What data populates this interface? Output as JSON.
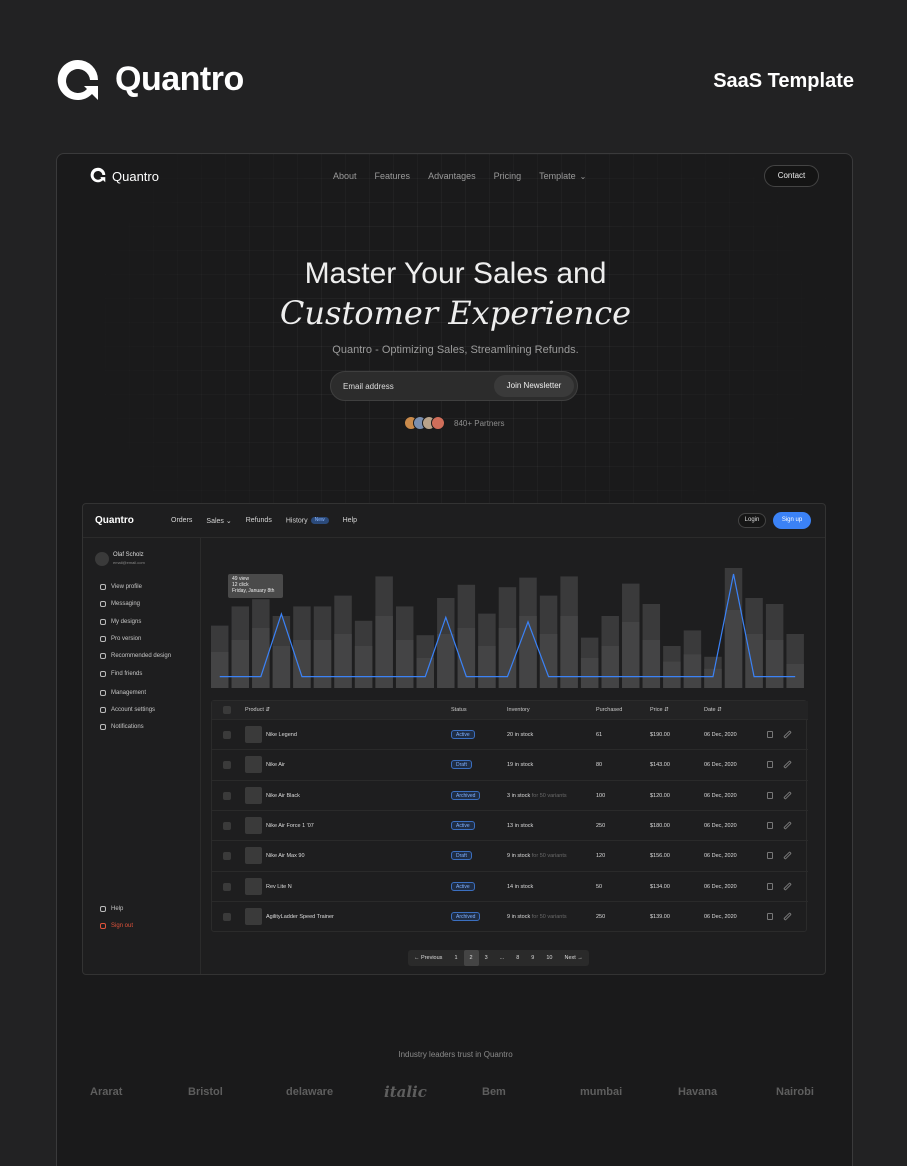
{
  "banner": {
    "brand": "Quantro",
    "tagline": "SaaS Template"
  },
  "site": {
    "logo_text": "Quantro",
    "nav": [
      "About",
      "Features",
      "Advantages",
      "Pricing",
      "Template"
    ],
    "contact": "Contact",
    "hero_line1": "Master Your Sales and",
    "hero_line2": "Customer Experience",
    "subtitle": "Quantro - Optimizing Sales, Streamlining Refunds.",
    "email_placeholder": "Email address",
    "join_label": "Join Newsletter",
    "partners": "840+ Partners",
    "avatar_colors": [
      "#c98a4b",
      "#7a8fb0",
      "#b9a38a",
      "#d06e5a"
    ]
  },
  "dashboard": {
    "logo": "Quantro",
    "nav": [
      "Orders",
      "Sales",
      "Refunds",
      "History",
      "Help"
    ],
    "history_badge": "New",
    "login": "Login",
    "signup": "Sign up",
    "user": {
      "name": "Olaf Scholz",
      "email": "email@email.com"
    },
    "sidebar": [
      "View profile",
      "Messaging",
      "My designs",
      "Pro version",
      "Recommended design",
      "Find friends",
      "Management",
      "Account settings",
      "Notifications"
    ],
    "help": "Help",
    "signout": "Sign out",
    "tooltip": {
      "line1": "49 view",
      "line2": "12 click",
      "line3": "Friday, January 8th"
    },
    "table_headers": [
      "Product",
      "Status",
      "Inventory",
      "Purchased",
      "Price",
      "Date"
    ],
    "rows": [
      {
        "product": "Nike Legend",
        "status": "Active",
        "stock": "20 in stock",
        "variants": "",
        "purchased": "61",
        "price": "$190.00",
        "date": "06 Dec, 2020"
      },
      {
        "product": "Nike Air",
        "status": "Draft",
        "stock": "19 in stock",
        "variants": "",
        "purchased": "80",
        "price": "$143.00",
        "date": "06 Dec, 2020"
      },
      {
        "product": "Nike Air Black",
        "status": "Archived",
        "stock": "3 in stock",
        "variants": "for 50 variants",
        "purchased": "100",
        "price": "$120.00",
        "date": "06 Dec, 2020"
      },
      {
        "product": "Nike Air Force 1 '07",
        "status": "Active",
        "stock": "13 in stock",
        "variants": "",
        "purchased": "250",
        "price": "$180.00",
        "date": "06 Dec, 2020"
      },
      {
        "product": "Nike Air Max 90",
        "status": "Draft",
        "stock": "9 in stock",
        "variants": "for 50 variants",
        "purchased": "120",
        "price": "$156.00",
        "date": "06 Dec, 2020"
      },
      {
        "product": "Rev Lite N",
        "status": "Active",
        "stock": "14 in stock",
        "variants": "",
        "purchased": "50",
        "price": "$134.00",
        "date": "06 Dec, 2020"
      },
      {
        "product": "AgilityLadder Speed Trainer",
        "status": "Archived",
        "stock": "9 in stock",
        "variants": "for 50 variants",
        "purchased": "250",
        "price": "$139.00",
        "date": "06 Dec, 2020"
      }
    ],
    "pagination": [
      "Previous",
      "1",
      "2",
      "3",
      "...",
      "8",
      "9",
      "10",
      "Next"
    ],
    "active_page": "2"
  },
  "trust": {
    "heading": "Industry leaders trust in Quantro",
    "logos": [
      "Ararat",
      "Bristol",
      "delaware",
      "italic",
      "Bem",
      "mumbai",
      "Havana",
      "Nairobi"
    ]
  },
  "chart_data": {
    "type": "bar",
    "bars": [
      0.52,
      0.68,
      0.74,
      0.6,
      0.68,
      0.68,
      0.77,
      0.56,
      0.93,
      0.68,
      0.44,
      0.75,
      0.86,
      0.62,
      0.84,
      0.92,
      0.77,
      0.93,
      0.42,
      0.6,
      0.87,
      0.7,
      0.35,
      0.48,
      0.26,
      1.0,
      0.75,
      0.7,
      0.45
    ],
    "inner": [
      0.3,
      0.4,
      0.5,
      0.35,
      0.4,
      0.4,
      0.45,
      0.35,
      0.6,
      0.4,
      0.25,
      0.45,
      0.5,
      0.35,
      0.5,
      0.6,
      0.45,
      0.6,
      0.25,
      0.35,
      0.55,
      0.4,
      0.22,
      0.28,
      0.16,
      0.65,
      0.45,
      0.4,
      0.2
    ],
    "line": [
      0.1,
      0.1,
      0.1,
      0.65,
      0.1,
      0.1,
      0.1,
      0.1,
      0.1,
      0.1,
      0.1,
      0.62,
      0.1,
      0.1,
      0.1,
      0.58,
      0.1,
      0.1,
      0.1,
      0.1,
      0.1,
      0.1,
      0.1,
      0.1,
      0.1,
      1.0,
      0.1,
      0.1,
      0.1
    ],
    "accent": "#3b82f6"
  }
}
